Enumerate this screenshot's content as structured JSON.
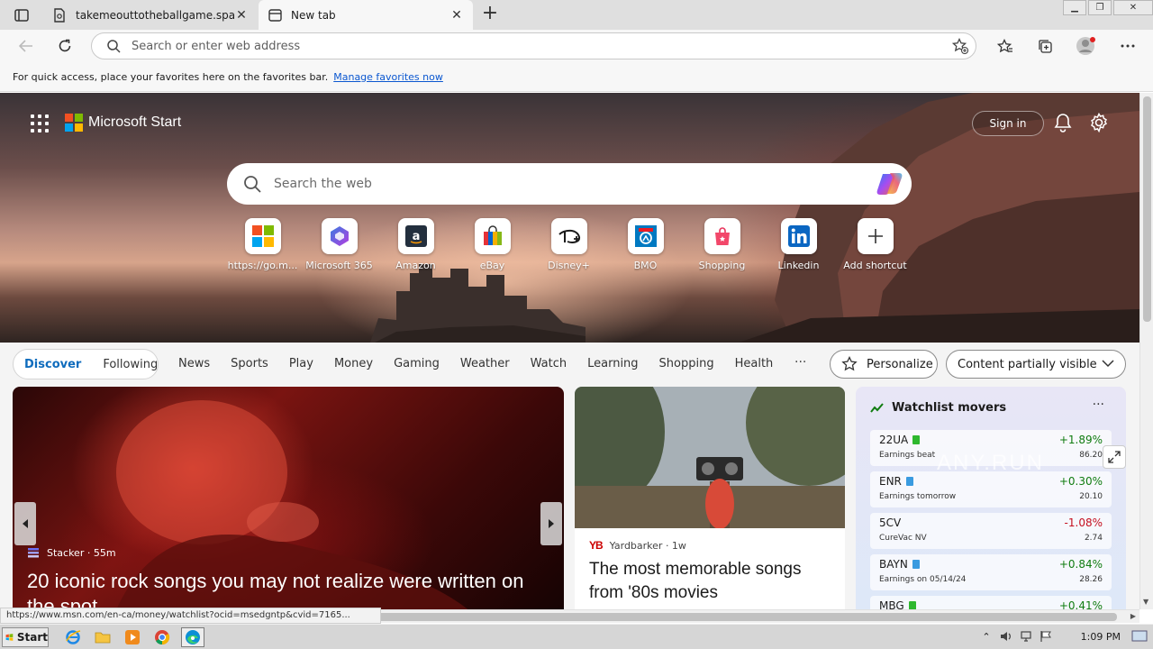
{
  "browser": {
    "tabs": [
      {
        "title": "takemeouttotheballgame.space",
        "active": false
      },
      {
        "title": "New tab",
        "active": true
      }
    ],
    "address_placeholder": "Search or enter web address",
    "favorites_bar": {
      "message": "For quick access, place your favorites here on the favorites bar.",
      "link": "Manage favorites now"
    },
    "status_url": "https://www.msn.com/en-ca/money/watchlist?ocid=msedgntp&cvid=7165..."
  },
  "ntp": {
    "brand": "Microsoft Start",
    "signin": "Sign in",
    "search_placeholder": "Search the web",
    "shortcuts": [
      {
        "label": "https://go.m...",
        "icon": "windows-logo-icon"
      },
      {
        "label": "Microsoft 365",
        "icon": "m365-icon"
      },
      {
        "label": "Amazon",
        "icon": "amazon-icon"
      },
      {
        "label": "eBay",
        "icon": "ebay-bag-icon"
      },
      {
        "label": "Disney+",
        "icon": "disney-plus-icon"
      },
      {
        "label": "BMO",
        "icon": "bmo-icon"
      },
      {
        "label": "Shopping",
        "icon": "shopping-bag-icon"
      },
      {
        "label": "Linkedin",
        "icon": "linkedin-icon"
      },
      {
        "label": "Add shortcut",
        "icon": "plus-icon"
      }
    ],
    "feed_toggle": {
      "discover": "Discover",
      "following": "Following"
    },
    "nav": [
      "News",
      "Sports",
      "Play",
      "Money",
      "Gaming",
      "Weather",
      "Watch",
      "Learning",
      "Shopping",
      "Health"
    ],
    "more": "···",
    "personalize": "Personalize",
    "visibility": "Content partially visible"
  },
  "cards": {
    "main": {
      "source": "Stacker · 55m",
      "headline": "20 iconic rock songs you may not realize were written on the spot"
    },
    "second": {
      "source_logo": "YB",
      "source": "Yardbarker · 1w",
      "headline": "The most memorable songs from '80s movies"
    }
  },
  "watchlist": {
    "title": "Watchlist movers",
    "more": "···",
    "rows": [
      {
        "symbol": "22UA",
        "sub": "Earnings beat",
        "change": "+1.89%",
        "price": "86.20",
        "dir": "up",
        "badge": "#2eb82e"
      },
      {
        "symbol": "ENR",
        "sub": "Earnings tomorrow",
        "change": "+0.30%",
        "price": "20.10",
        "dir": "up",
        "badge": "#3a9be0"
      },
      {
        "symbol": "5CV",
        "sub": "CureVac NV",
        "change": "-1.08%",
        "price": "2.74",
        "dir": "down",
        "badge": ""
      },
      {
        "symbol": "BAYN",
        "sub": "Earnings on 05/14/24",
        "change": "+0.84%",
        "price": "28.26",
        "dir": "up",
        "badge": "#3a9be0"
      },
      {
        "symbol": "MBG",
        "sub": "",
        "change": "+0.41%",
        "price": "",
        "dir": "up",
        "badge": "#2eb82e"
      }
    ]
  },
  "watermark": "ANY.RUN",
  "taskbar": {
    "start": "Start",
    "clock": "1:09 PM"
  }
}
